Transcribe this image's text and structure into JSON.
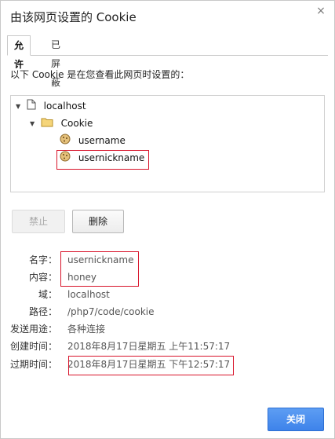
{
  "dialog": {
    "title": "由该网页设置的 Cookie",
    "close_glyph": "×"
  },
  "tabs": [
    {
      "label": "允许",
      "active": true
    },
    {
      "label": "已屏蔽",
      "active": false
    }
  ],
  "intro": "以下 Cookie 是在您查看此网页时设置的：",
  "tree": {
    "host": "localhost",
    "folder": "Cookie",
    "cookies": [
      "username",
      "usernickname"
    ],
    "selected": "usernickname"
  },
  "buttons": {
    "block": "禁止",
    "delete": "删除",
    "close": "关闭"
  },
  "details": [
    {
      "label": "名字：",
      "value": "usernickname"
    },
    {
      "label": "内容：",
      "value": "honey"
    },
    {
      "label": "域：",
      "value": "localhost"
    },
    {
      "label": "路径：",
      "value": "/php7/code/cookie"
    },
    {
      "label": "发送用途：",
      "value": "各种连接"
    },
    {
      "label": "创建时间：",
      "value": "2018年8月17日星期五 上午11:57:17"
    },
    {
      "label": "过期时间：",
      "value": "2018年8月17日星期五 下午12:57:17"
    }
  ],
  "colors": {
    "accent": "#3e83ea",
    "highlight_border": "#d8142a"
  }
}
